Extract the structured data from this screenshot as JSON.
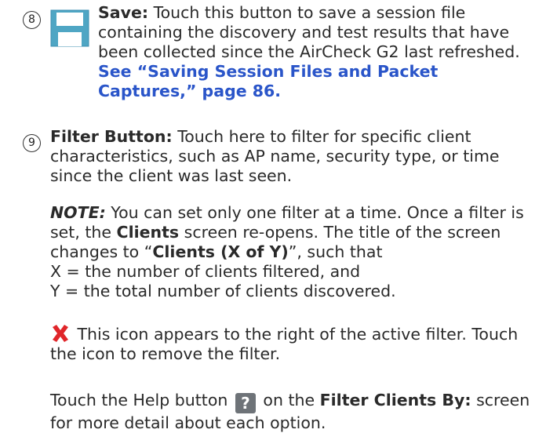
{
  "save_item": {
    "number": "8",
    "icon": "save-icon",
    "title": "Save:",
    "text": " Touch this button to save a session file containing the discovery and test results that have been collected since the AirCheck G2 last refreshed. ",
    "link": "See “Saving Session Files and Packet Captures,” page 86."
  },
  "filter_item": {
    "number": "9",
    "title": "Filter Button:",
    "text": " Touch here to filter for specific client characteristics, such as AP name, security type, or time since the client was last seen."
  },
  "note": {
    "label": "NOTE:",
    "text1": " You can set only one filter at a time. Once a filter is set, the ",
    "clients_bold": "Clients",
    "text2": " screen re-opens. The title of the screen changes to “",
    "title_bold": "Clients (X of Y)",
    "text3": "”, such that",
    "line_x": "X = the number of clients filtered, and",
    "line_y": "Y = the total number of clients discovered."
  },
  "remove_para": {
    "icon": "red-x-icon",
    "text": " This icon appears to the right of the active filter. Touch the icon to remove the filter."
  },
  "help_para": {
    "text1": "Touch the Help button ",
    "icon": "help-icon",
    "icon_glyph": "?",
    "text2": " on the ",
    "bold": "Filter Clients By:",
    "text3": " screen for more detail about each option."
  },
  "colors": {
    "link": "#2a55c9",
    "save_icon": "#4fa6c4",
    "x_icon": "#e0262a",
    "help_bg": "#6e7378"
  }
}
